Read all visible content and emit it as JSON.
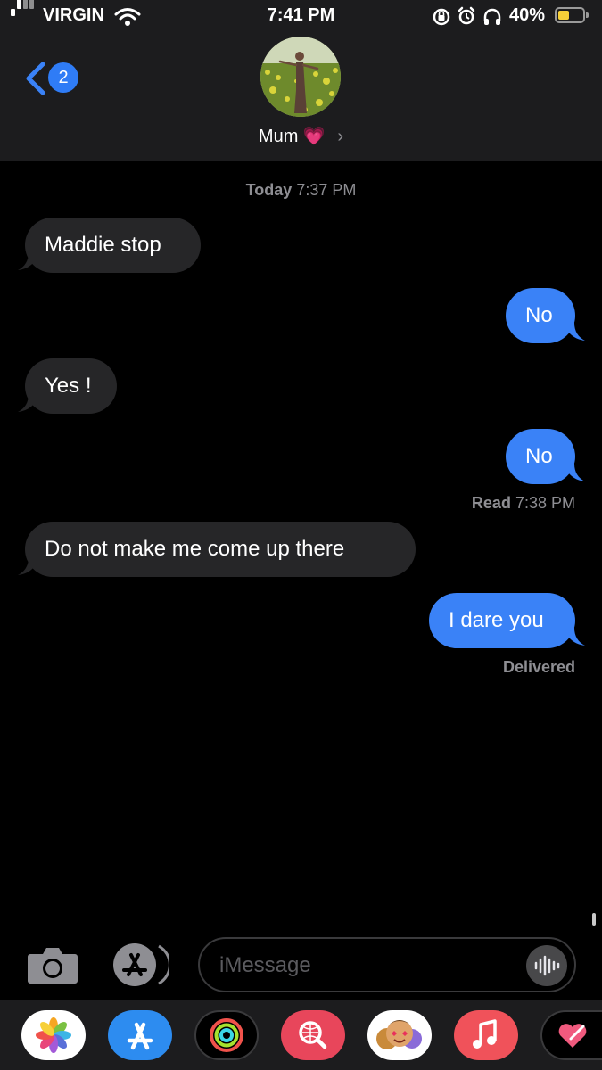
{
  "status_bar": {
    "carrier": "VIRGIN",
    "time": "7:41 PM",
    "battery_percent": "40%",
    "battery_level": 0.4,
    "icons": [
      "signal-icon",
      "wifi-icon",
      "rotation-lock-icon",
      "alarm-icon",
      "headphones-icon",
      "battery-icon"
    ]
  },
  "header": {
    "back_icon": "chevron-left-icon",
    "unread_count": "2",
    "contact_name": "Mum 💗",
    "chevron": "›"
  },
  "thread": {
    "timestamp_day": "Today",
    "timestamp_time": "7:37 PM",
    "messages": [
      {
        "text": "Maddie stop",
        "direction": "received"
      },
      {
        "text": "No",
        "direction": "sent"
      },
      {
        "text": "Yes !",
        "direction": "received"
      },
      {
        "text": "No",
        "direction": "sent",
        "receipt_label": "Read",
        "receipt_time": "7:38 PM"
      },
      {
        "text": "Do not make me come up there",
        "direction": "received"
      },
      {
        "text": "I dare you",
        "direction": "sent",
        "receipt_label": "Delivered"
      }
    ]
  },
  "composer": {
    "placeholder": "iMessage",
    "camera_icon": "camera-icon",
    "apps_icon": "app-store-icon",
    "audio_icon": "audio-waveform-icon"
  },
  "app_drawer": {
    "apps": [
      "photos-icon",
      "app-store-icon",
      "activity-icon",
      "web-search-icon",
      "memoji-icon",
      "music-icon",
      "digital-touch-icon"
    ]
  },
  "colors": {
    "sent_bubble": "#3a82f7",
    "received_bubble": "#262628",
    "header_bg": "#1c1c1e",
    "badge": "#2f7cf6",
    "battery_fill": "#f7d038"
  }
}
